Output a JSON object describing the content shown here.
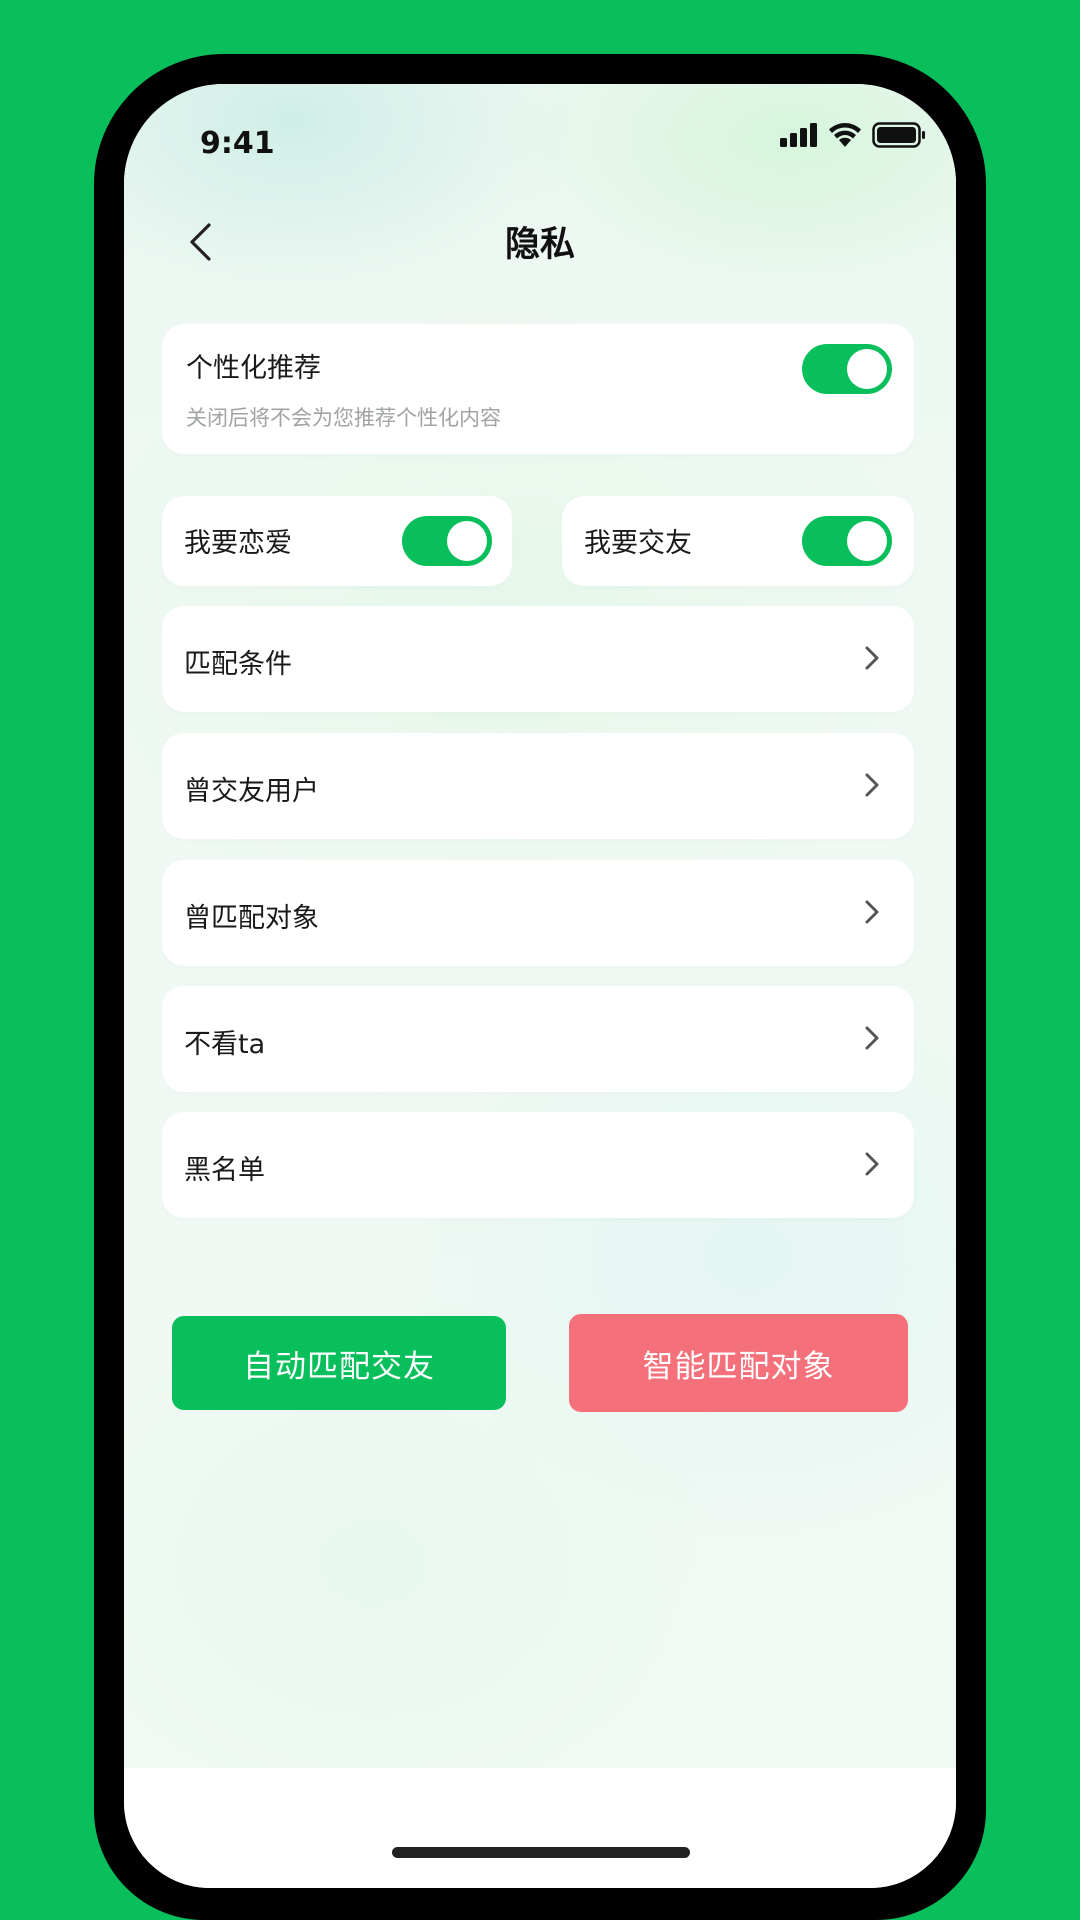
{
  "status_bar": {
    "time": "9:41",
    "icons": [
      "signal-icon",
      "wifi-icon",
      "battery-icon"
    ]
  },
  "nav": {
    "back_icon": "chevron-left-icon",
    "title": "隐私"
  },
  "personalized": {
    "title": "个性化推荐",
    "subtitle": "关闭后将不会为您推荐个性化内容",
    "toggle_on": true
  },
  "love": {
    "label": "我要恋爱",
    "toggle_on": true
  },
  "friends": {
    "label": "我要交友",
    "toggle_on": true
  },
  "rows": [
    {
      "label": "匹配条件"
    },
    {
      "label": "曾交友用户"
    },
    {
      "label": "曾匹配对象"
    },
    {
      "label": "不看ta"
    },
    {
      "label": "黑名单"
    }
  ],
  "buttons": {
    "auto_match_friend": "自动匹配交友",
    "smart_match_partner": "智能匹配对象"
  },
  "colors": {
    "brand_green": "#09bf5b",
    "accent_pink": "#f4707a",
    "background": "#eef8f2"
  }
}
